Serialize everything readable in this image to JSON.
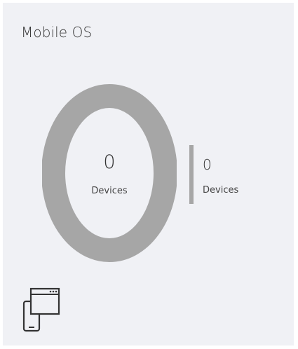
{
  "tile": {
    "title": "Mobile OS"
  },
  "donut": {
    "value": "0",
    "label": "Devices",
    "ring_color": "#a6a6a6",
    "background": "#f0f1f5"
  },
  "legend": {
    "value": "0",
    "label": "Devices",
    "bar_color": "#a6a6a6"
  },
  "icon": {
    "name": "devices-icon"
  }
}
